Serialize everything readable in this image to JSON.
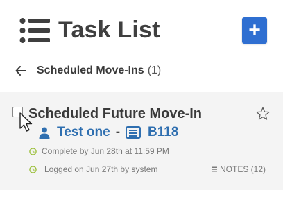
{
  "header": {
    "title": "Task List",
    "add_label": "+"
  },
  "breadcrumb": {
    "title": "Scheduled Move-Ins",
    "count": "(1)"
  },
  "task": {
    "title": "Scheduled Future Move-In",
    "tenant": "Test one",
    "separator": "-",
    "unit": "B118",
    "complete_by": "Complete by Jun 28th at 11:59 PM",
    "logged_on": "Logged on Jun 27th by system",
    "notes": "NOTES (12)"
  },
  "colors": {
    "accent": "#2f6fd1",
    "link": "#2f6fb0",
    "clock": "#9bbf3a",
    "card_bg": "#f4f4f4"
  },
  "icons": [
    "list-icon",
    "plus-icon",
    "arrow-left-icon",
    "checkbox",
    "cursor-icon",
    "star-icon",
    "person-icon",
    "unit-icon",
    "clock-icon",
    "notes-icon"
  ]
}
